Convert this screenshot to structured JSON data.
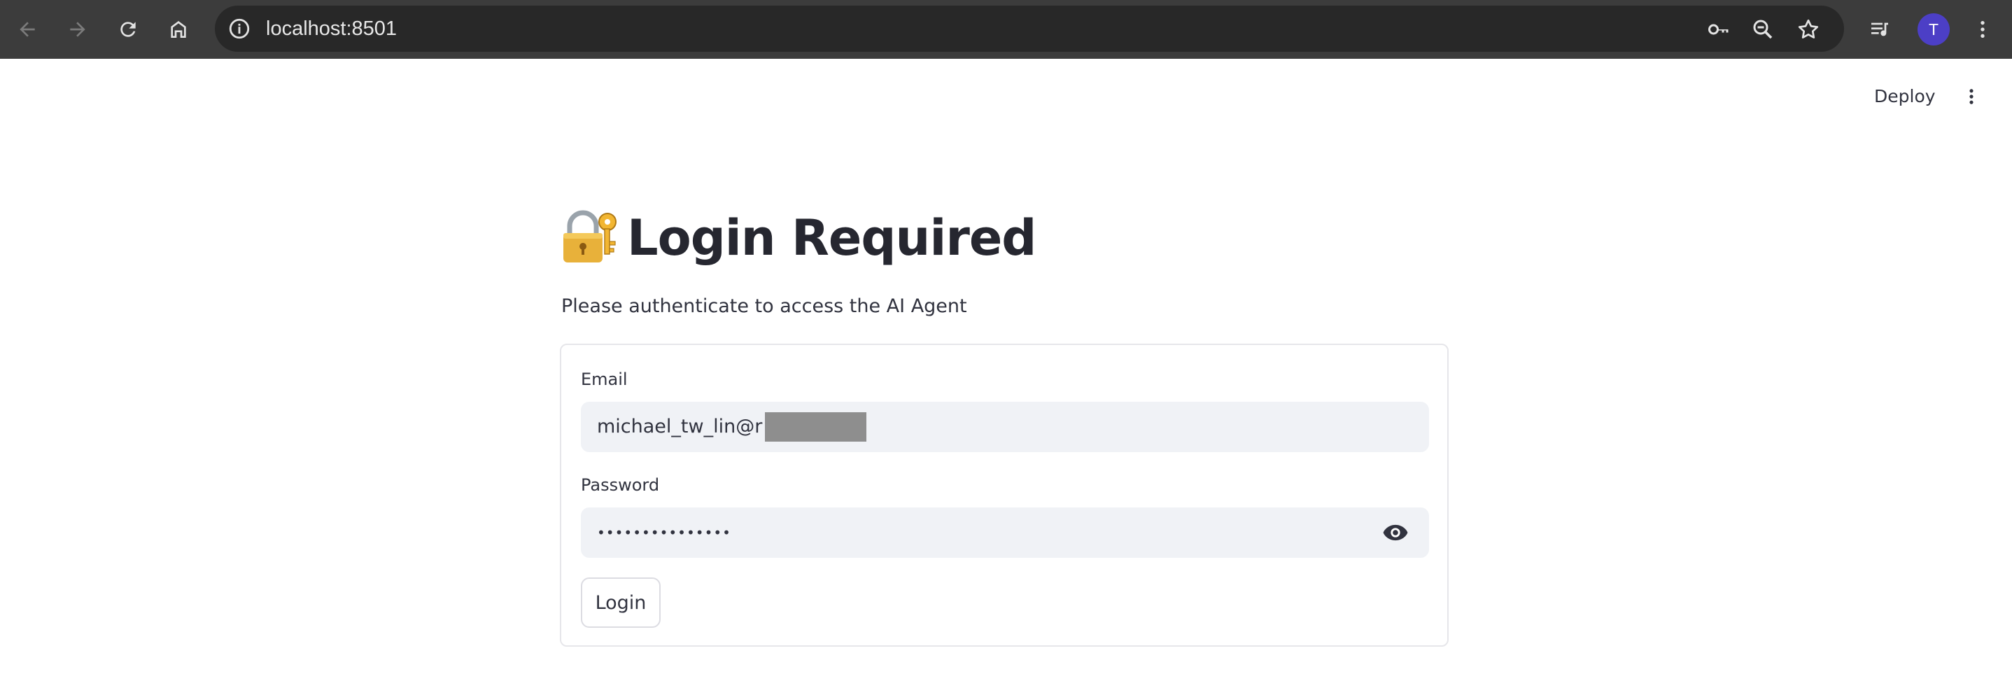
{
  "browser": {
    "url": "localhost:8501",
    "avatar_letter": "T",
    "buttons": {
      "back": "back-arrow-icon",
      "forward": "forward-arrow-icon",
      "reload": "reload-icon",
      "home": "home-icon"
    },
    "omnibox_icons": [
      "site-info-icon",
      "password-key-icon",
      "zoom-icon",
      "bookmark-star-icon"
    ],
    "toolbar_icons": [
      "reading-list-icon",
      "chrome-menu-icon"
    ]
  },
  "app_header": {
    "deploy_label": "Deploy",
    "menu_icon": "kebab-menu-icon"
  },
  "page": {
    "title_icon": "locked-with-key-icon",
    "title": "Login Required",
    "subtitle": "Please authenticate to access the AI Agent"
  },
  "form": {
    "email_label": "Email",
    "email_value": "michael_tw_lin@r",
    "email_redacted": true,
    "password_label": "Password",
    "password_masked": "•••••••••••••••",
    "password_toggle_icon": "eye-icon",
    "submit_label": "Login"
  },
  "colors": {
    "browser_bar": "#3c3c3c",
    "omnibox": "#282828",
    "avatar": "#4c3fc6",
    "input_bg": "#f0f2f6",
    "text": "#31333f",
    "redaction": "#8e8e8e"
  }
}
